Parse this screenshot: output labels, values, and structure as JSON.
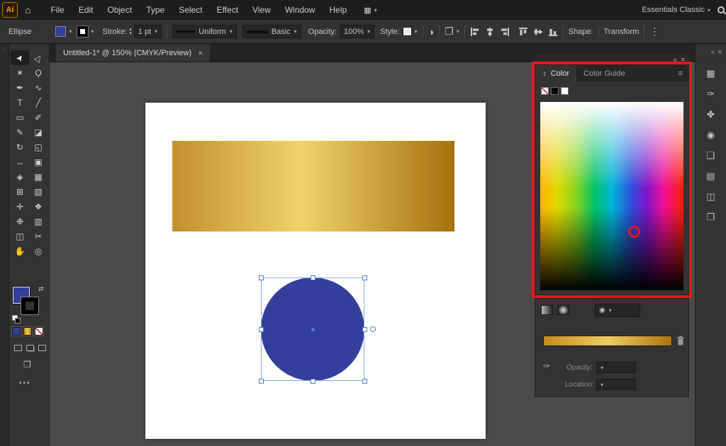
{
  "app": {
    "logo": "Ai"
  },
  "menubar": {
    "items": [
      "File",
      "Edit",
      "Object",
      "Type",
      "Select",
      "Effect",
      "View",
      "Window",
      "Help"
    ],
    "workspace": "Essentials Classic"
  },
  "controlbar": {
    "tool": "Ellipse",
    "stroke_label": "Stroke:",
    "stroke_value": "1 pt",
    "profile": "Uniform",
    "brush": "Basic",
    "opacity_label": "Opacity:",
    "opacity_value": "100%",
    "style_label": "Style:",
    "shape_label": "Shape:",
    "transform": "Transform"
  },
  "tabbar": {
    "title": "Untitled-1* @ 150% (CMYK/Preview)",
    "close": "×"
  },
  "tools": [
    {
      "name": "selection-tool",
      "glyph": "➤"
    },
    {
      "name": "direct-selection-tool",
      "glyph": "▷"
    },
    {
      "name": "magic-wand-tool",
      "glyph": "✶"
    },
    {
      "name": "lasso-tool",
      "glyph": "Ϙ"
    },
    {
      "name": "pen-tool",
      "glyph": "✒"
    },
    {
      "name": "curvature-tool",
      "glyph": "∿"
    },
    {
      "name": "type-tool",
      "glyph": "T"
    },
    {
      "name": "line-segment-tool",
      "glyph": "╱"
    },
    {
      "name": "rectangle-tool",
      "glyph": "▭"
    },
    {
      "name": "paintbrush-tool",
      "glyph": "✐"
    },
    {
      "name": "shaper-tool",
      "glyph": "✎"
    },
    {
      "name": "eraser-tool",
      "glyph": "◪"
    },
    {
      "name": "rotate-tool",
      "glyph": "↻"
    },
    {
      "name": "scale-tool",
      "glyph": "◱"
    },
    {
      "name": "width-tool",
      "glyph": "↔"
    },
    {
      "name": "free-transform-tool",
      "glyph": "▣"
    },
    {
      "name": "shape-builder-tool",
      "glyph": "◈"
    },
    {
      "name": "perspective-grid-tool",
      "glyph": "▦"
    },
    {
      "name": "mesh-tool",
      "glyph": "⊞"
    },
    {
      "name": "gradient-tool",
      "glyph": "▧"
    },
    {
      "name": "eyedropper-tool",
      "glyph": "✛"
    },
    {
      "name": "blend-tool",
      "glyph": "❖"
    },
    {
      "name": "symbol-sprayer-tool",
      "glyph": "❉"
    },
    {
      "name": "column-graph-tool",
      "glyph": "▥"
    },
    {
      "name": "artboard-tool",
      "glyph": "◫"
    },
    {
      "name": "slice-tool",
      "glyph": "✂"
    },
    {
      "name": "hand-tool",
      "glyph": "✋"
    },
    {
      "name": "zoom-tool",
      "glyph": "◎"
    }
  ],
  "toolbar_extras": {
    "ellipsis": "•••"
  },
  "right_dock": {
    "icons": [
      {
        "name": "swatches-panel",
        "glyph": "▦"
      },
      {
        "name": "brushes-panel",
        "glyph": "✑"
      },
      {
        "name": "symbols-panel",
        "glyph": "✤"
      },
      {
        "name": "gradient-panel",
        "glyph": "◉"
      },
      {
        "name": "appearance-panel",
        "glyph": "❏"
      },
      {
        "name": "layers-panel",
        "glyph": "▤"
      },
      {
        "name": "artboards-panel",
        "glyph": "◫"
      },
      {
        "name": "libraries-panel",
        "glyph": "❐"
      }
    ]
  },
  "color_panel": {
    "tab_color": "Color",
    "tab_guide": "Color Guide"
  },
  "gradient_panel": {
    "opacity_label": "Opacity:",
    "location_label": "Location:"
  },
  "icons": {
    "home": "⌂",
    "arrange": "▦",
    "menu": "≡",
    "collapse": "«",
    "swap": "⇄",
    "recolor": "◑",
    "doc_setup": "❐",
    "more": "⋮",
    "rail_dots": "∷",
    "panel_updown": "⇕",
    "eyedropper": "✑"
  },
  "colors": {
    "annotation_red": "#e8151b",
    "circle_blue": "#333f9c",
    "gold_start": "#c1912c",
    "gold_mid": "#f2d268",
    "gold_end": "#a3720c"
  },
  "styles": {
    "gold_rect": "background:linear-gradient(90deg,#c1912c 0%,#f2d268 46%,#a3720c 100%)",
    "circle": "background:#333f9c",
    "fill_chip": "background:#333f9c",
    "gradient_bar": "background:linear-gradient(90deg,#c08c1e 0%,#f0ce62 50%,#a87410 100%)",
    "mini_gradient": "background:linear-gradient(90deg,#c08c1e 0%,#f0ce62 50%,#a87410 100%)"
  }
}
